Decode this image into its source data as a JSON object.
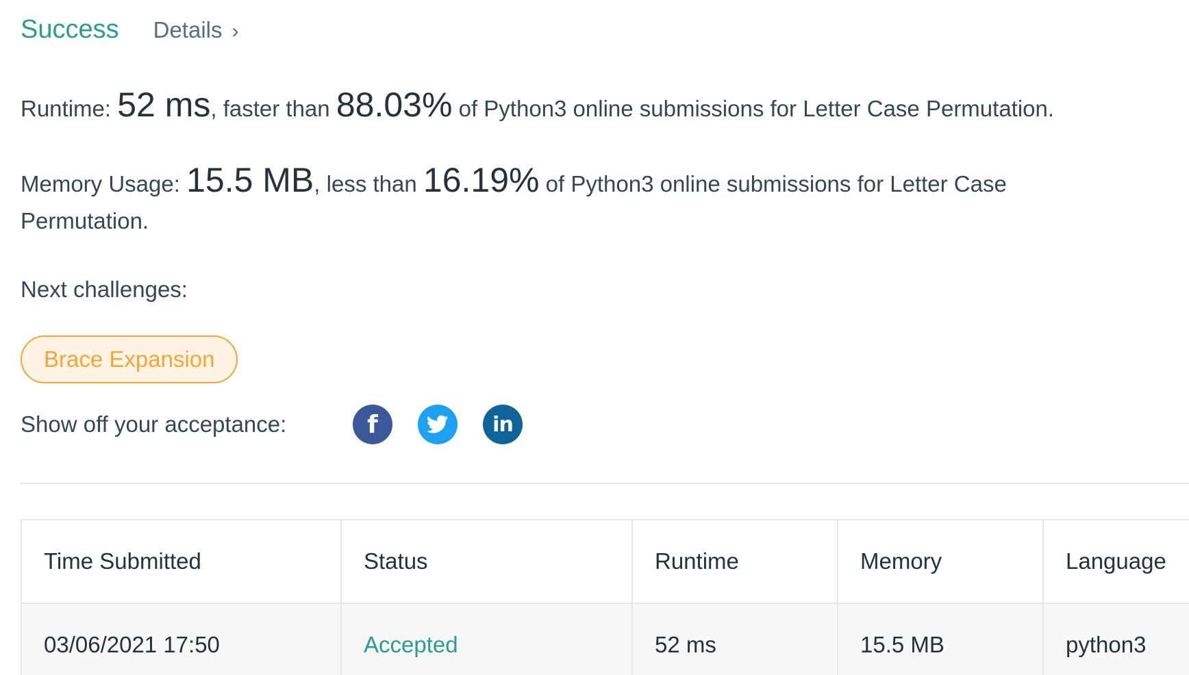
{
  "header": {
    "status": "Success",
    "details_label": "Details",
    "details_chevron": "›"
  },
  "runtime_stat": {
    "label": "Runtime: ",
    "value": "52 ms",
    "mid": ", faster than ",
    "percent": "88.03%",
    "tail": " of Python3 online submissions for Letter Case Permutation."
  },
  "memory_stat": {
    "label": "Memory Usage: ",
    "value": "15.5 MB",
    "mid": ", less than ",
    "percent": "16.19%",
    "tail": " of Python3 online submissions for Letter Case Permutation."
  },
  "next": {
    "label": "Next challenges:",
    "challenges": [
      "Brace Expansion"
    ]
  },
  "share": {
    "label": "Show off your acceptance:",
    "icons": [
      "facebook-icon",
      "twitter-icon",
      "linkedin-icon"
    ],
    "facebook_glyph": "f",
    "linkedin_glyph": "in"
  },
  "table": {
    "headers": [
      "Time Submitted",
      "Status",
      "Runtime",
      "Memory",
      "Language"
    ],
    "rows": [
      [
        "03/06/2021 17:50",
        "Accepted",
        "52 ms",
        "15.5 MB",
        "python3"
      ]
    ]
  },
  "colors": {
    "success": "#2a9d8f",
    "tag_border": "#f5a53a",
    "tag_bg": "#fff3e3",
    "facebook": "#3b5998",
    "twitter": "#1da1f2",
    "linkedin": "#0e6499"
  }
}
